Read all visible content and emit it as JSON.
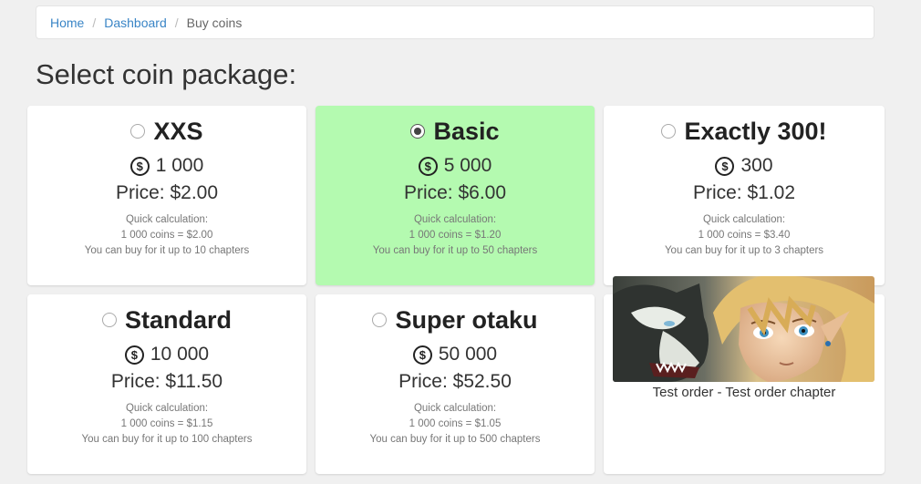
{
  "breadcrumb": {
    "home": "Home",
    "dashboard": "Dashboard",
    "current": "Buy coins",
    "separator": "/"
  },
  "page": {
    "title": "Select coin package:"
  },
  "calc_label": "Quick calculation:",
  "coin_symbol": "$",
  "packages": [
    {
      "name": "XXS",
      "coins": "1 000",
      "price": "Price: $2.00",
      "rate": "1 000 coins = $2.00",
      "chapters": "You can buy for it up to 10 chapters",
      "selected": false
    },
    {
      "name": "Basic",
      "coins": "5 000",
      "price": "Price: $6.00",
      "rate": "1 000 coins = $1.20",
      "chapters": "You can buy for it up to 50 chapters",
      "selected": true
    },
    {
      "name": "Exactly 300!",
      "coins": "300",
      "price": "Price: $1.02",
      "rate": "1 000 coins = $3.40",
      "chapters": "You can buy for it up to 3 chapters",
      "selected": false
    },
    {
      "name": "Standard",
      "coins": "10 000",
      "price": "Price: $11.50",
      "rate": "1 000 coins = $1.15",
      "chapters": "You can buy for it up to 100 chapters",
      "selected": false
    },
    {
      "name": "Super otaku",
      "coins": "50 000",
      "price": "Price: $52.50",
      "rate": "1 000 coins = $1.05",
      "chapters": "You can buy for it up to 500 chapters",
      "selected": false
    }
  ],
  "chapter": {
    "caption": "Test order - Test order chapter"
  },
  "colors": {
    "selected_bg": "#b4fab0",
    "link": "#3a85c6"
  }
}
